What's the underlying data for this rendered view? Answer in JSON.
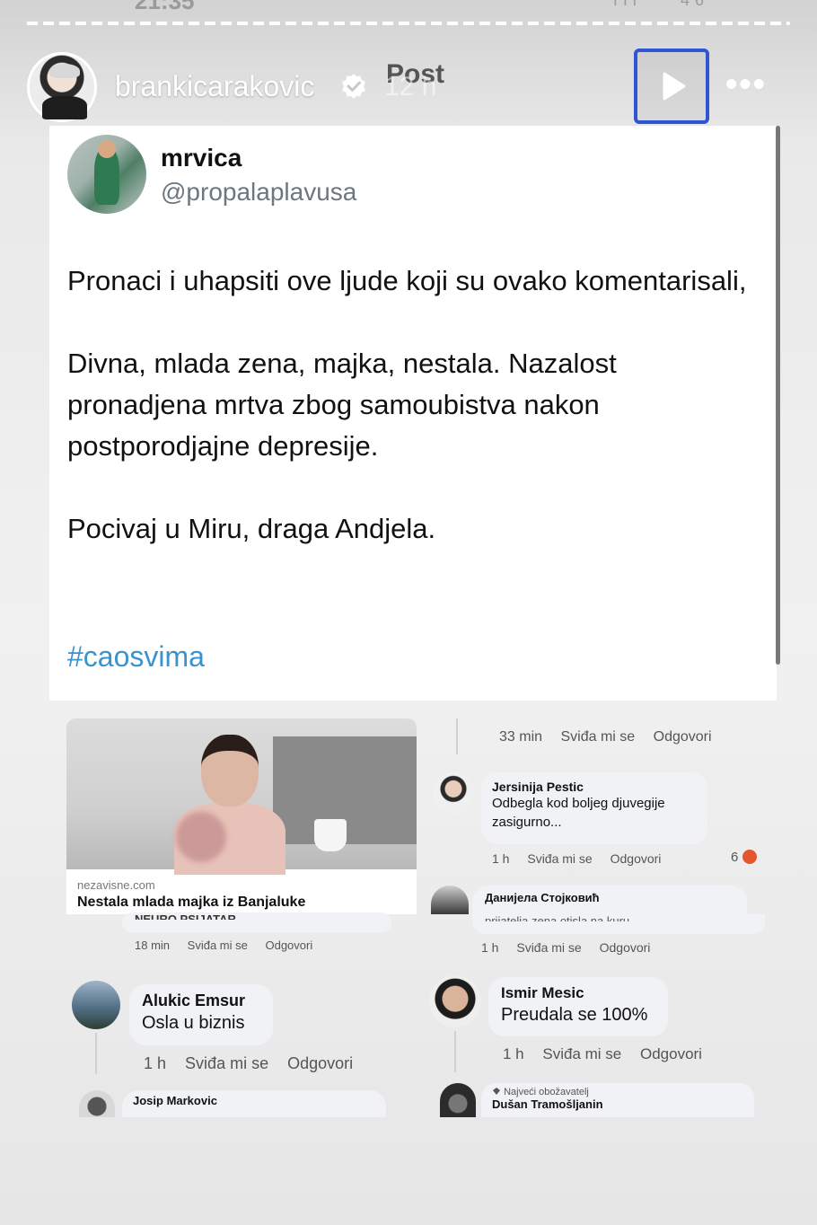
{
  "status_bar": {
    "time": "21:35",
    "icons": "ııl ⌃ 46"
  },
  "story": {
    "progress": 0.72,
    "username": "brankicarakovic",
    "time_ago": "12 h",
    "post_label": "Post",
    "play_icon": "play-icon",
    "more_label": "•••"
  },
  "tweet": {
    "name": "mrvica",
    "handle": "@propalaplavusa",
    "paragraphs": [
      "Pronaci i uhapsiti ove ljude koji su ovako komentarisali, ",
      "Divna, mlada zena, majka, nestala. Nazalost pronadjena mrtva zbog samoubistva nakon postporodjajne depresije.",
      "Pocivaj u Miru, draga Andjela."
    ],
    "hashtag": "#caosvima"
  },
  "news": {
    "source": "nezavisne.com",
    "title": "Nestala mlada majka iz Banjaluke"
  },
  "comments_left": [
    {
      "cut_name": "NEURO PSIJATAR",
      "time": "18 min",
      "like": "Sviđa mi se",
      "reply": "Odgovori"
    },
    {
      "name": "Alukic Emsur",
      "text": "Osla u biznis",
      "time": "1 h",
      "like": "Sviđa mi se",
      "reply": "Odgovori"
    },
    {
      "name": "Josip Markovic"
    }
  ],
  "comments_right": [
    {
      "time": "33 min",
      "like": "Sviđa mi se",
      "reply": "Odgovori"
    },
    {
      "name": "Jersinija Pestic",
      "text": "Odbegla kod boljeg djuvegije zasigurno...",
      "time": "1 h",
      "like": "Sviđa mi se",
      "reply": "Odgovori",
      "reactions": "6"
    },
    {
      "name": "Данијела Стојковић",
      "cut_text": "prijateljа zena otisla na kuru",
      "time": "1 h",
      "like": "Sviđa mi se",
      "reply": "Odgovori"
    },
    {
      "name": "Ismir Mesic",
      "text": "Preudala se 100%",
      "time": "1 h",
      "like": "Sviđa mi se",
      "reply": "Odgovori"
    },
    {
      "badge": "Najveći obožavatelj",
      "name": "Dušan Tramošljanin"
    }
  ]
}
